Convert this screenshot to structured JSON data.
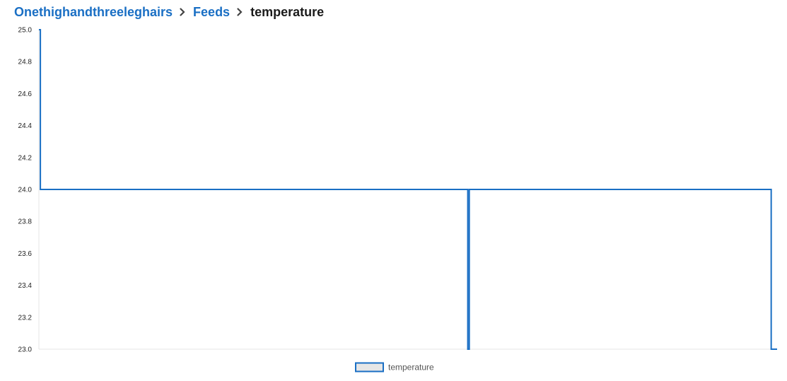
{
  "breadcrumb": {
    "items": [
      {
        "label": "Onethighandthreeleghairs",
        "link": true
      },
      {
        "label": "Feeds",
        "link": true
      },
      {
        "label": "temperature",
        "link": false
      }
    ]
  },
  "colors": {
    "line": "#1a6fc4",
    "link": "#1a6fc4",
    "legend_fill": "#e6e6e6"
  },
  "chart_data": {
    "type": "line",
    "title": "",
    "xlabel": "",
    "ylabel": "",
    "ylim": [
      23.0,
      25.0
    ],
    "yticks": [
      "25.0",
      "24.8",
      "24.6",
      "24.4",
      "24.2",
      "24.0",
      "23.8",
      "23.6",
      "23.4",
      "23.2",
      "23.0"
    ],
    "grid": false,
    "legend_position": "bottom-center",
    "x_domain": [
      0,
      1
    ],
    "series": [
      {
        "name": "temperature",
        "step": true,
        "points": [
          {
            "x": 0.0,
            "y": 25.0
          },
          {
            "x": 0.002,
            "y": 24.0
          },
          {
            "x": 0.58,
            "y": 24.0
          },
          {
            "x": 0.581,
            "y": 23.0
          },
          {
            "x": 0.583,
            "y": 24.0
          },
          {
            "x": 0.991,
            "y": 24.0
          },
          {
            "x": 0.992,
            "y": 23.0
          },
          {
            "x": 1.0,
            "y": 23.0
          }
        ]
      }
    ]
  }
}
